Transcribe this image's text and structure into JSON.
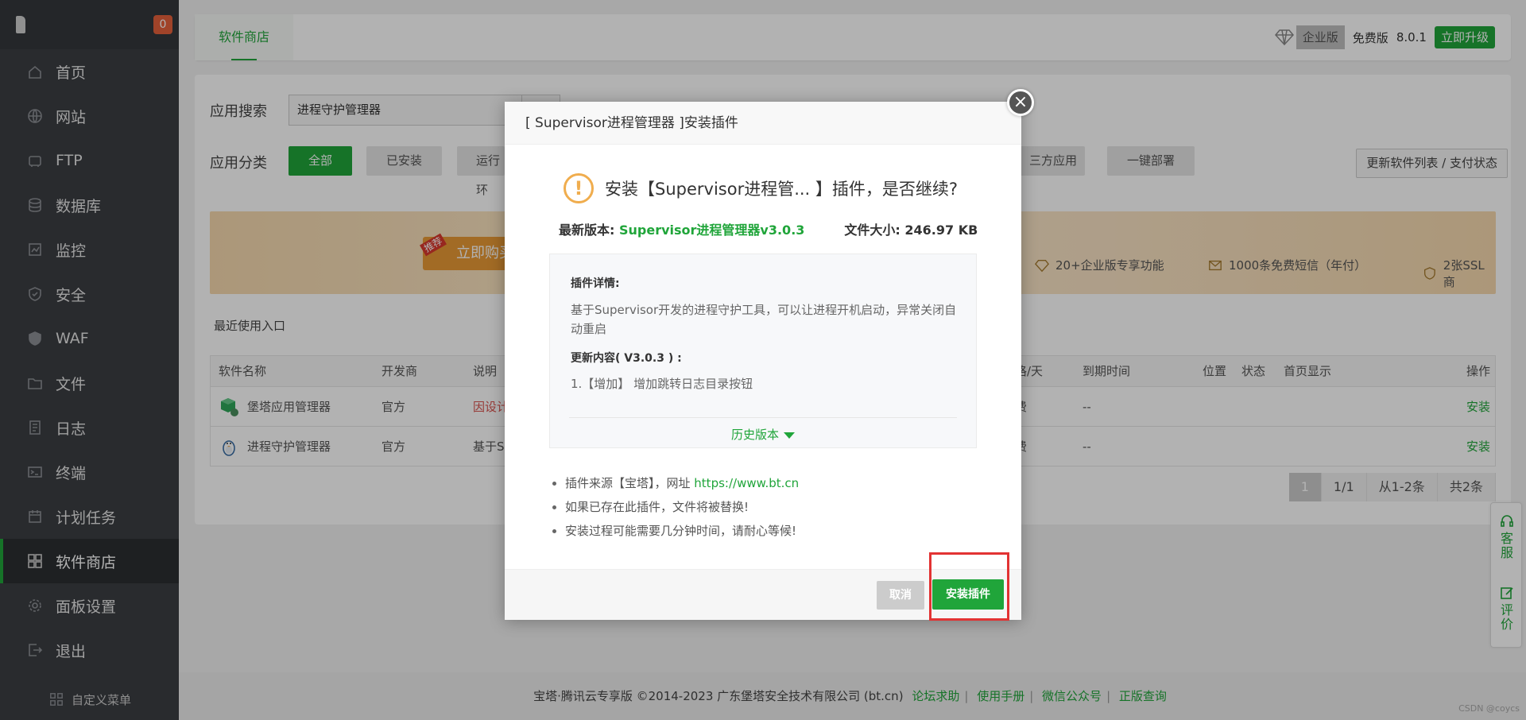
{
  "sidebar": {
    "badge": "0",
    "items": [
      {
        "label": "首页",
        "icon": "home-icon"
      },
      {
        "label": "网站",
        "icon": "globe-icon"
      },
      {
        "label": "FTP",
        "icon": "ftp-icon"
      },
      {
        "label": "数据库",
        "icon": "database-icon"
      },
      {
        "label": "监控",
        "icon": "monitor-icon"
      },
      {
        "label": "安全",
        "icon": "shield-icon"
      },
      {
        "label": "WAF",
        "icon": "waf-shield-icon"
      },
      {
        "label": "文件",
        "icon": "folder-icon"
      },
      {
        "label": "日志",
        "icon": "log-icon"
      },
      {
        "label": "终端",
        "icon": "terminal-icon"
      },
      {
        "label": "计划任务",
        "icon": "calendar-icon"
      },
      {
        "label": "软件商店",
        "icon": "grid-icon",
        "active": true
      },
      {
        "label": "面板设置",
        "icon": "settings-icon"
      },
      {
        "label": "退出",
        "icon": "logout-icon"
      }
    ],
    "custom_menu": "自定义菜单"
  },
  "topbar": {
    "tab": "软件商店",
    "edition_enterprise": "企业版",
    "edition_free": "免费版",
    "version": "8.0.1",
    "upgrade": "立即升级"
  },
  "main": {
    "search_label": "应用搜索",
    "search_value": "进程守护管理器",
    "category_label": "应用分类",
    "categories": [
      "全部",
      "已安装",
      "运行环",
      "三方应用",
      "一键部署"
    ],
    "refresh": "更新软件列表 / 支付状态",
    "banner": {
      "recommend": "推荐",
      "buy": "立即购买",
      "features": [
        "20+企业版专享功能",
        "1000条免费短信（年付）",
        "2张SSL商"
      ]
    },
    "recent": "最近使用入口",
    "table": {
      "headers": [
        "软件名称",
        "开发商",
        "说明",
        "格/天",
        "到期时间",
        "位置",
        "状态",
        "首页显示",
        "操作"
      ],
      "rows": [
        {
          "name": "堡塔应用管理器",
          "vendor": "官方",
          "desc": "因设计",
          "price": "费",
          "expire": "--",
          "action": "安装"
        },
        {
          "name": "进程守护管理器",
          "vendor": "官方",
          "desc": "基于Su",
          "price": "费",
          "expire": "--",
          "action": "安装"
        }
      ]
    },
    "pager": [
      "1",
      "1/1",
      "从1-2条",
      "共2条"
    ]
  },
  "float": {
    "service": "客服",
    "review": "评价"
  },
  "footer": {
    "copyright": "宝塔·腾讯云专享版 ©2014-2023 广东堡塔安全技术有限公司 (bt.cn)",
    "links": [
      "论坛求助",
      "使用手册",
      "微信公众号",
      "正版查询"
    ],
    "watermark": "CSDN @coycs"
  },
  "modal": {
    "title": "[ Supervisor进程管理器 ]安装插件",
    "question": "安装【Supervisor进程管... 】插件，是否继续?",
    "latest_label": "最新版本:",
    "latest_value": "Supervisor进程管理器v3.0.3",
    "size_label": "文件大小:",
    "size_value": "246.97 KB",
    "detail_title": "插件详情:",
    "detail_text": "基于Supervisor开发的进程守护工具，可以让进程开机启动，异常关闭自动重启",
    "update_title": "更新内容( V3.0.3 ) :",
    "update_item": "1.【增加】 增加跳转日志目录按钮",
    "history": "历史版本",
    "note1_pre": "插件来源【宝塔】，网址",
    "note1_link": "https://www.bt.cn",
    "note2": "如果已存在此插件，文件将被替换!",
    "note3": "安装过程可能需要几分钟时间，请耐心等候!",
    "cancel": "取消",
    "install": "安装插件",
    "close": "×"
  },
  "colors": {
    "accent": "#20a53a",
    "highlight": "#e23333",
    "warning": "#f0ad4e"
  }
}
